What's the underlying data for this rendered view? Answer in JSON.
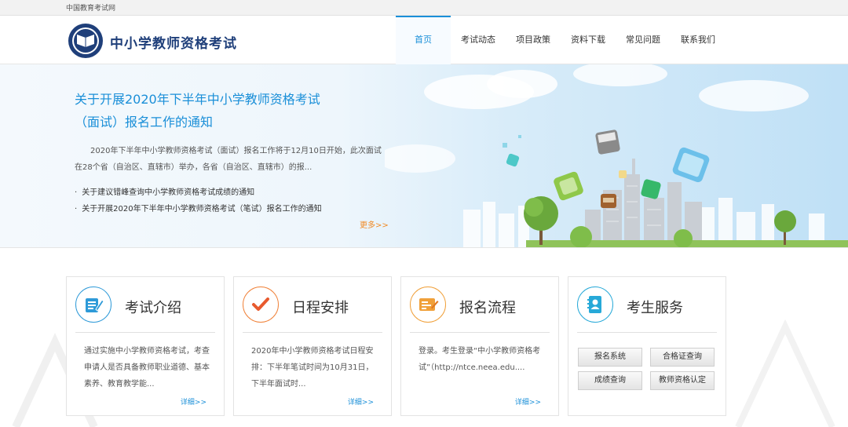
{
  "topstrip": {
    "text": "中国教育考试网"
  },
  "header": {
    "site_title": "中小学教师资格考试",
    "nav": [
      {
        "label": "首页",
        "active": true
      },
      {
        "label": "考试动态",
        "active": false
      },
      {
        "label": "项目政策",
        "active": false
      },
      {
        "label": "资料下载",
        "active": false
      },
      {
        "label": "常见问题",
        "active": false
      },
      {
        "label": "联系我们",
        "active": false
      }
    ]
  },
  "banner": {
    "title_line1": "关于开展2020年下半年中小学教师资格考试",
    "title_line2": "（面试）报名工作的通知",
    "summary": "2020年下半年中小学教师资格考试（面试）报名工作将于12月10日开始，此次面试在28个省（自治区、直辖市）举办，各省（自治区、直辖市）的报...",
    "links": [
      "关于建议错峰查询中小学教师资格考试成绩的通知",
      "关于开展2020年下半年中小学教师资格考试（笔试）报名工作的通知"
    ],
    "more": "更多>>",
    "bullet": "·"
  },
  "cards": [
    {
      "title": "考试介绍",
      "desc": "通过实施中小学教师资格考试，考查申请人是否具备教师职业道德、基本素养、教育教学能...",
      "detail": "详细>>",
      "icon": "book-pen-icon",
      "color": "#2e9ad8"
    },
    {
      "title": "日程安排",
      "desc": "2020年中小学教师资格考试日程安排：下半年笔试时间为10月31日，下半年面试时...",
      "detail": "详细>>",
      "icon": "checkmark-icon",
      "color": "#f0823a"
    },
    {
      "title": "报名流程",
      "desc": "登录。考生登录“中小学教师资格考试”（http://ntce.neea.edu....",
      "detail": "详细>>",
      "icon": "form-pen-icon",
      "color": "#f0a03a"
    },
    {
      "title": "考生服务",
      "icon": "contact-card-icon",
      "color": "#27a9d8",
      "services": [
        "报名系统",
        "合格证查询",
        "成绩查询",
        "教师资格认定"
      ]
    }
  ]
}
